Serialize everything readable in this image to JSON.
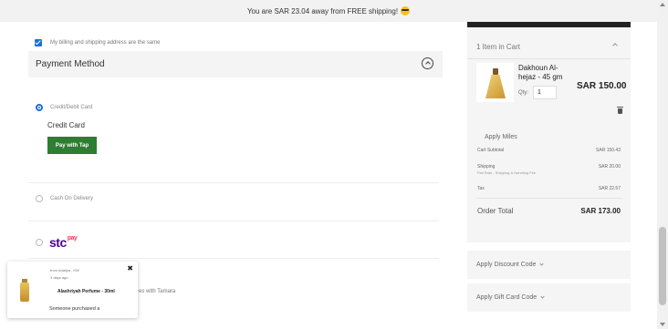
{
  "banner": {
    "text": "You are SAR 23.04 away from FREE shipping!",
    "emoji": "sunglasses-emoji"
  },
  "billing": {
    "same_address_label": "My billing and shipping address are the same",
    "checked": true
  },
  "payment": {
    "title": "Payment Method",
    "options": [
      {
        "label": "Credit/Debit Card",
        "selected": true
      },
      {
        "label": "Cash On Delivery",
        "selected": false
      },
      {
        "label": "stc pay",
        "selected": false
      }
    ],
    "credit_card_label": "Credit Card",
    "pay_button_label": "Pay with Tap",
    "stc_logo": {
      "main": "stc",
      "suffix": "pay"
    },
    "tamara_partial": "es with Tamara"
  },
  "popup": {
    "from": "from Adaliya , KW",
    "ago": "3 days ago",
    "product": "Alashriyah Perfume - 30ml",
    "purchased": "Someone purchased a"
  },
  "cart": {
    "title": "1 Item in Cart",
    "item": {
      "name": "Dakhoun Al-hejaz - 45 gm",
      "qty_label": "Qty:",
      "qty": "1",
      "price": "SAR 150.00"
    },
    "apply_miles": "Apply Miles",
    "summary": [
      {
        "label": "Cart Subtotal",
        "value": "SAR 150.43"
      },
      {
        "label": "Shipping",
        "value": "SAR 20.00"
      },
      {
        "label": "Tax",
        "value": "SAR 22.57"
      }
    ],
    "shipping_sub": "Flat Rate - Shipping & Handling Fee",
    "order_total_label": "Order Total",
    "order_total_value": "SAR 173.00"
  },
  "discount": {
    "label": "Apply Discount Code"
  },
  "gift_card": {
    "label": "Apply Gift Card Code"
  },
  "colors": {
    "accent": "#1e6fd9",
    "pay_button": "#2e7d32",
    "stc_purple": "#4f008c",
    "stc_pink": "#ff375e"
  }
}
